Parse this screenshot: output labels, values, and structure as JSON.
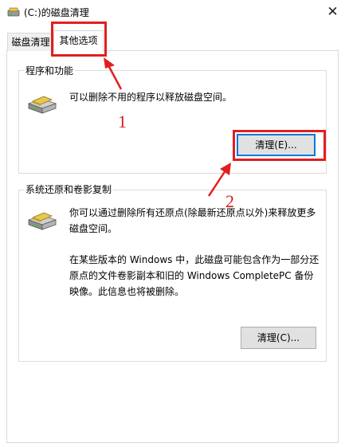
{
  "window": {
    "title": "(C:)的磁盘清理",
    "close_glyph": "✕"
  },
  "tabs": [
    {
      "label": "磁盘清理",
      "selected": false
    },
    {
      "label": "其他选项",
      "selected": true
    }
  ],
  "programs_group": {
    "title": "程序和功能",
    "description": "可以删除不用的程序以释放磁盘空间。",
    "button_label": "清理(E)..."
  },
  "restore_group": {
    "title": "系统还原和卷影复制",
    "description1": "你可以通过删除所有还原点(除最新还原点以外)来释放更多磁盘空间。",
    "description2": "在某些版本的 Windows 中，此磁盘可能包含作为一部分还原点的文件卷影副本和旧的 Windows CompletePC 备份映像。此信息也将被删除。",
    "button_label": "清理(C)..."
  },
  "annotations": {
    "step1": "1",
    "step2": "2",
    "color": "#e21e1e"
  },
  "icons": {
    "title": "disk-cleanup-icon",
    "disk": "disk-drive-icon"
  }
}
